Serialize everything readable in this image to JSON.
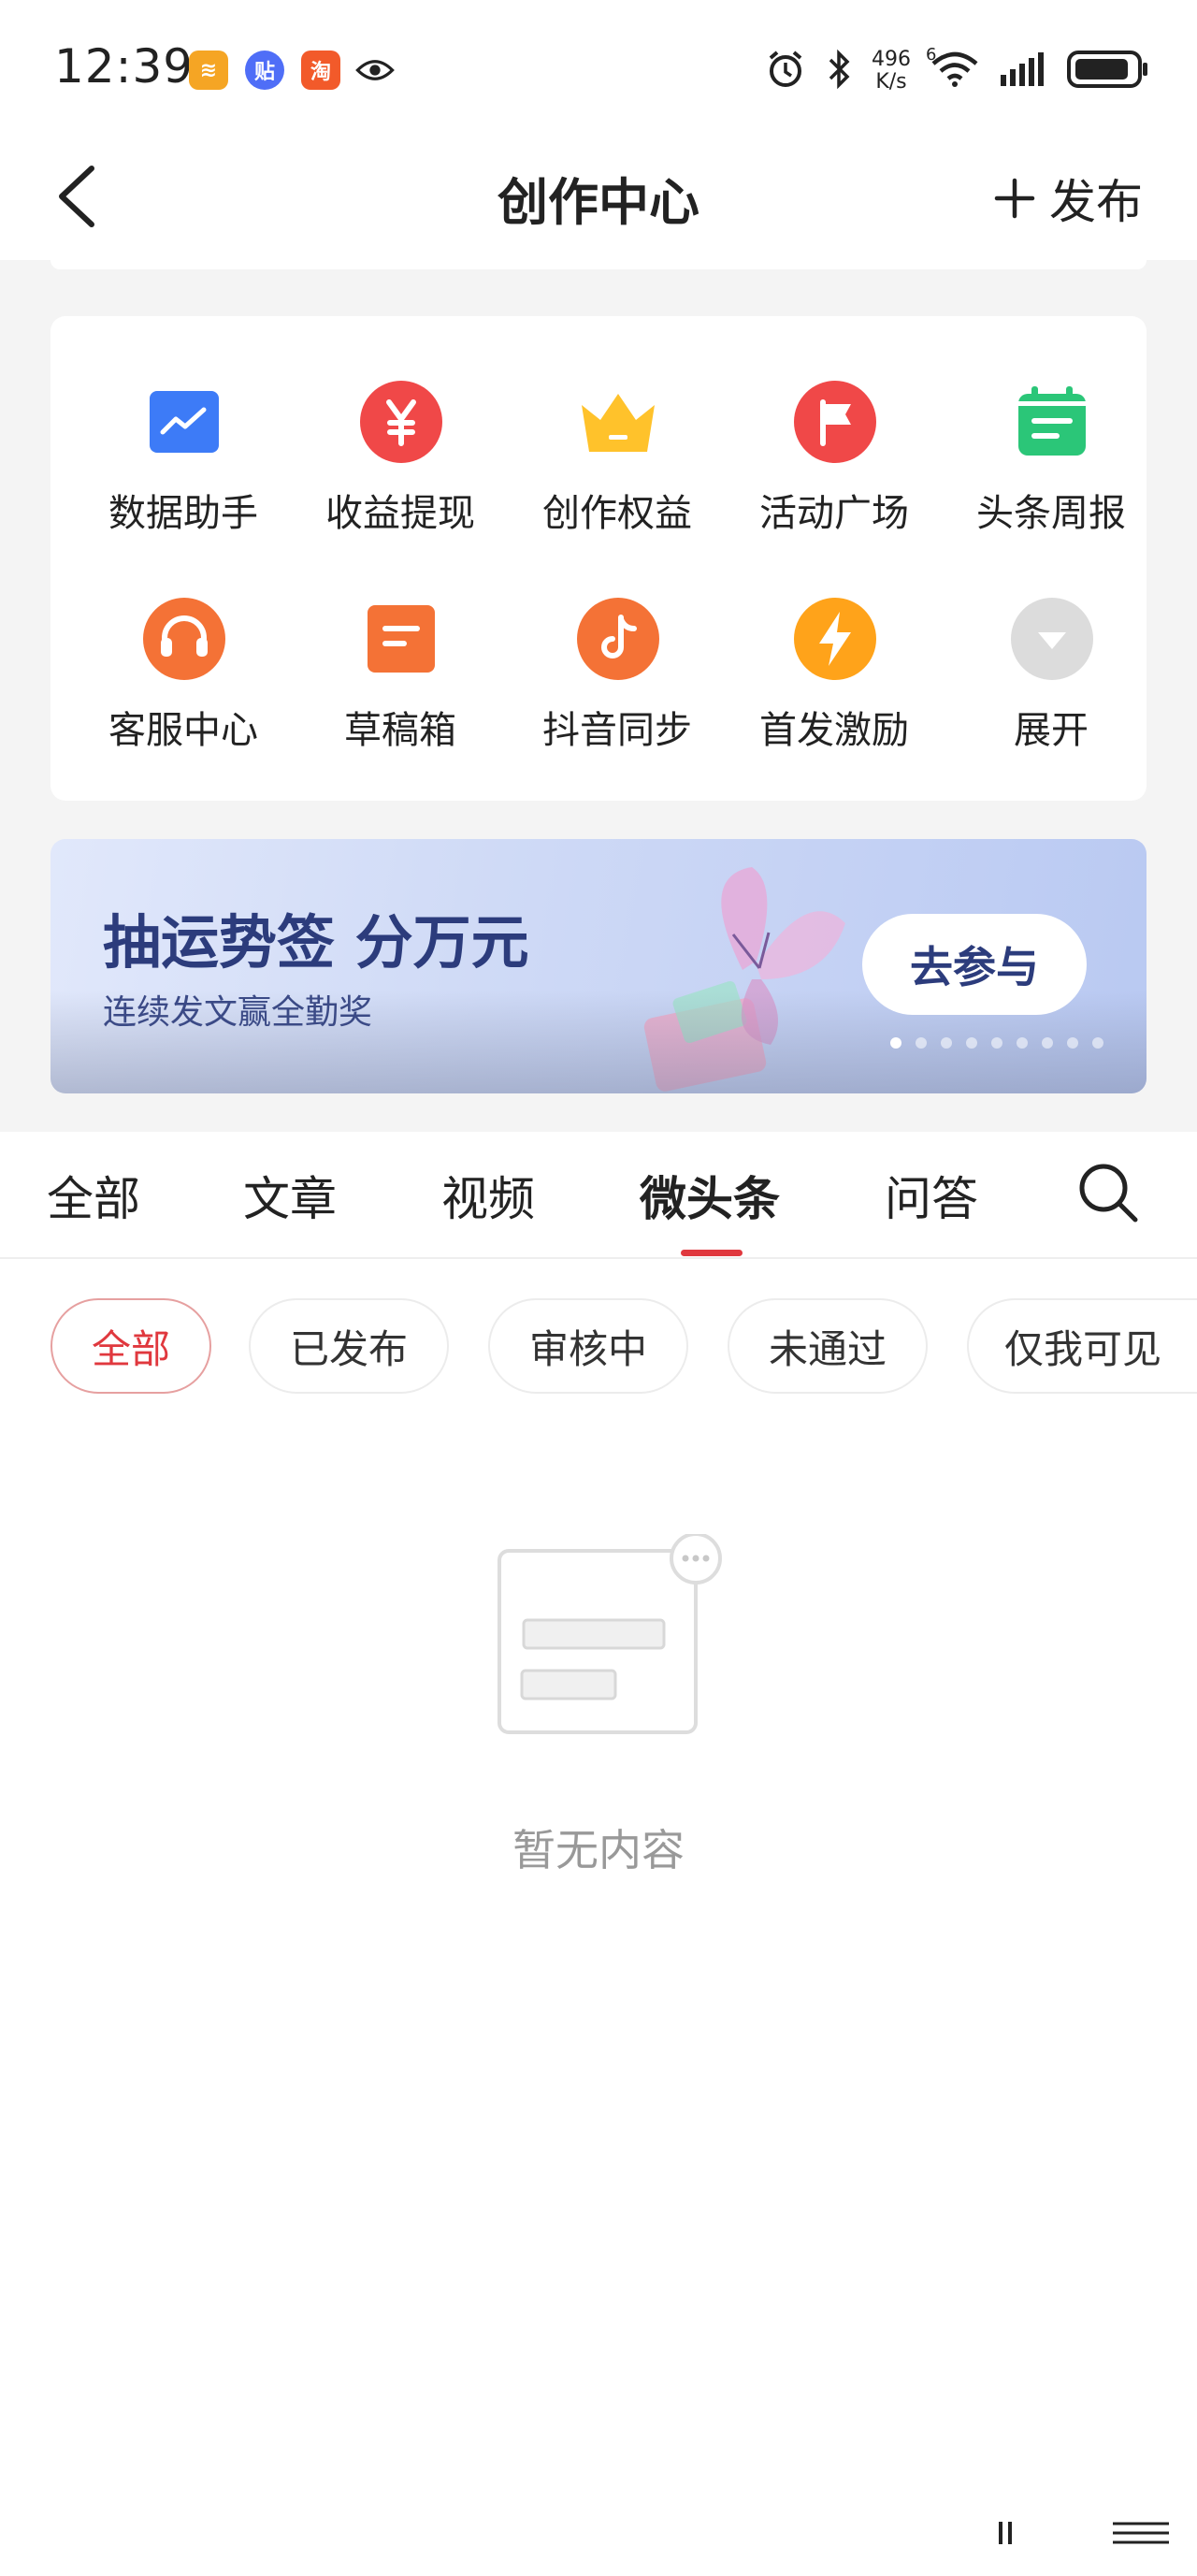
{
  "status_bar": {
    "time": "12:39",
    "apps": [
      {
        "name": "pinduoduo-app",
        "glyph": "≋",
        "color": "#f5a524"
      },
      {
        "name": "tieba-app",
        "glyph": "贴",
        "color": "#4f6ef7"
      },
      {
        "name": "taobao-app",
        "glyph": "淘",
        "color": "#f25a2a"
      }
    ],
    "speed_value": "496",
    "speed_unit": "K/s",
    "network_type": "6"
  },
  "nav": {
    "title": "创作中心",
    "publish_label": "发布"
  },
  "tools": [
    {
      "label": "数据助手",
      "icon": "chart-icon",
      "color": "#3d7bf7"
    },
    {
      "label": "收益提现",
      "icon": "yuan-icon",
      "color": "#f04848"
    },
    {
      "label": "创作权益",
      "icon": "crown-icon",
      "color": "#ffc22b"
    },
    {
      "label": "活动广场",
      "icon": "flag-icon",
      "color": "#f04848"
    },
    {
      "label": "头条周报",
      "icon": "calendar-icon",
      "color": "#2bc678"
    },
    {
      "label": "客服中心",
      "icon": "headset-icon",
      "color": "#f47236"
    },
    {
      "label": "草稿箱",
      "icon": "draft-icon",
      "color": "#f47236"
    },
    {
      "label": "抖音同步",
      "icon": "douyin-icon",
      "color": "#f47236"
    },
    {
      "label": "首发激励",
      "icon": "lightning-icon",
      "color": "#ffa31a"
    },
    {
      "label": "展开",
      "icon": "chevron-down-icon",
      "color": "#dcdcdc"
    }
  ],
  "banner": {
    "title": "抽运势签 分万元",
    "subtitle": "连续发文赢全勤奖",
    "button_label": "去参与",
    "page_count": 9,
    "active_page": 0
  },
  "tabs": [
    {
      "label": "全部",
      "active": false
    },
    {
      "label": "文章",
      "active": false
    },
    {
      "label": "视频",
      "active": false
    },
    {
      "label": "微头条",
      "active": true
    },
    {
      "label": "问答",
      "active": false
    }
  ],
  "filters": [
    {
      "label": "全部",
      "active": true
    },
    {
      "label": "已发布",
      "active": false
    },
    {
      "label": "审核中",
      "active": false
    },
    {
      "label": "未通过",
      "active": false
    },
    {
      "label": "仅我可见",
      "active": false
    }
  ],
  "empty_state": {
    "message": "暂无内容"
  },
  "colors": {
    "accent": "#e0383e",
    "banner_text": "#2c3c7c",
    "page_bg": "#f4f4f4"
  }
}
